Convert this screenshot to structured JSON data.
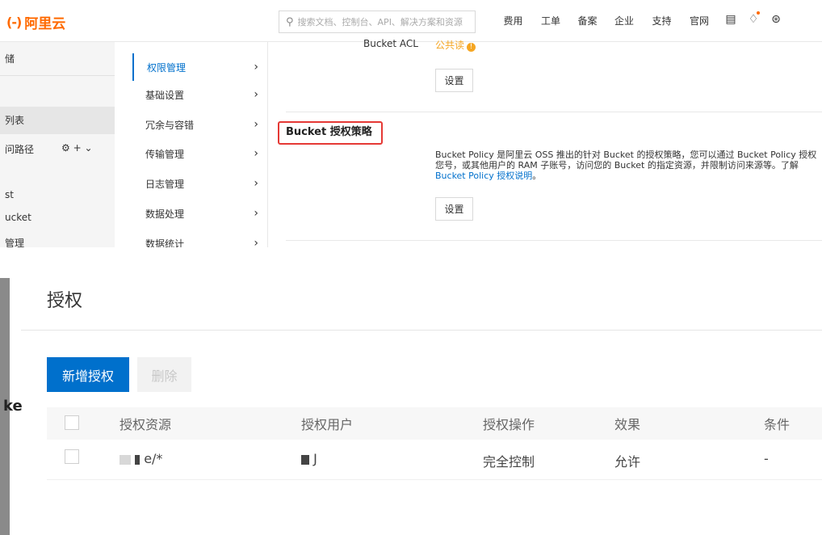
{
  "topbar": {
    "logo_text": "阿里云",
    "logo_mark": "(-)",
    "search_placeholder": "搜索文档、控制台、API、解决方案和资源",
    "nav": [
      "费用",
      "工单",
      "备案",
      "企业",
      "支持",
      "官网"
    ],
    "icons": [
      "terminal-icon",
      "bell-icon",
      "cart-icon"
    ]
  },
  "left_col": {
    "items": [
      "储",
      "列表",
      "问路径",
      "st",
      "ucket",
      "管理"
    ]
  },
  "mid_col": {
    "items": [
      "权限管理",
      "基础设置",
      "冗余与容错",
      "传输管理",
      "日志管理",
      "数据处理",
      "数据统计"
    ]
  },
  "content": {
    "acl_label": "Bucket ACL",
    "acl_value": "公共读",
    "set_label": "设置",
    "policy_title": "Bucket 授权策略",
    "policy_desc": "Bucket Policy 是阿里云 OSS 推出的针对 Bucket 的授权策略，您可以通过 Bucket Policy 授权您号，或其他用户的 RAM 子账号，访问您的 Bucket 的指定资源，并限制访问来源等。了解",
    "policy_link": "Bucket Policy 授权说明",
    "policy_link_suffix": "。"
  },
  "auth": {
    "title": "授权",
    "add_button": "新增授权",
    "delete_button": "删除",
    "strip_text": "ke",
    "columns": [
      "授权资源",
      "授权用户",
      "授权操作",
      "效果",
      "条件"
    ],
    "rows": [
      {
        "resource_suffix": "e/*",
        "user_suffix": "J",
        "action": "完全控制",
        "effect": "允许",
        "condition": "-"
      }
    ]
  }
}
